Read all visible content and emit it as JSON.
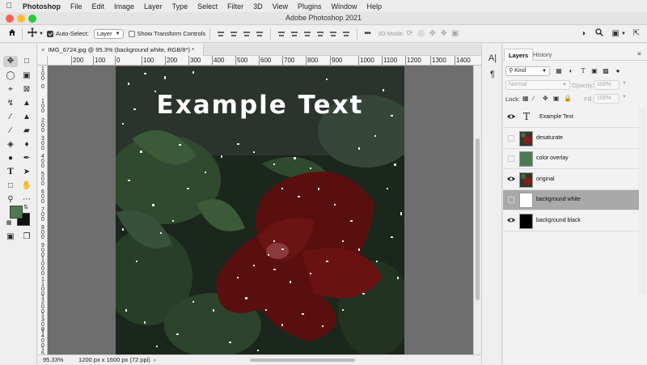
{
  "menubar": {
    "app": "Photoshop",
    "items": [
      "File",
      "Edit",
      "Image",
      "Layer",
      "Type",
      "Select",
      "Filter",
      "3D",
      "View",
      "Plugins",
      "Window",
      "Help"
    ]
  },
  "window": {
    "title": "Adobe Photoshop 2021"
  },
  "options_bar": {
    "auto_select_label": "Auto-Select:",
    "auto_select_value": "Layer",
    "show_transform_label": "Show Transform Controls",
    "mode_3d_label": "3D Mode:"
  },
  "document": {
    "tab_title": "IMG_6724.jpg @ 95.3% (background white, RGB/8*) *",
    "close_glyph": "×",
    "canvas_text": "Example Text"
  },
  "rulers": {
    "top": [
      "200",
      "100",
      "0",
      "100",
      "200",
      "300",
      "400",
      "500",
      "600",
      "700",
      "800",
      "900",
      "1000",
      "1100",
      "1200",
      "1300",
      "1400"
    ],
    "left": [
      "1\n0\n0",
      "0",
      "1\n0\n0",
      "2\n0\n0",
      "3\n0\n0",
      "4\n0\n0",
      "5\n0\n0",
      "6\n0\n0",
      "7\n0\n0",
      "8\n0\n0",
      "9\n0\n0",
      "1\n0\n0\n0",
      "1\n1\n0\n0",
      "1\n2\n0\n0",
      "1\n3\n0\n0",
      "1\n4\n0\n0",
      "1\n5\n0\n0"
    ]
  },
  "status": {
    "zoom": "95.33%",
    "dimensions": "1200 px x 1600 px (72 ppi)",
    "arrow": "›"
  },
  "colors": {
    "foreground": "#4d7a52",
    "background": "#111111",
    "selected_layer": "#a9a9a9"
  },
  "layers_panel": {
    "tabs": [
      "Layers",
      "History"
    ],
    "filter_label": "Kind",
    "blend_mode": "Normal",
    "opacity_label": "Opacity:",
    "opacity_value": "100%",
    "lock_label": "Lock:",
    "fill_label": "Fill:",
    "fill_value": "100%",
    "layers": [
      {
        "name": "Example Text",
        "visible": true,
        "kind": "text",
        "thumb_color": ""
      },
      {
        "name": "desaturate",
        "visible": false,
        "kind": "image",
        "thumb_color": "#2d3a2a"
      },
      {
        "name": "color overlay",
        "visible": false,
        "kind": "fill",
        "thumb_color": "#4d7a52"
      },
      {
        "name": "original",
        "visible": true,
        "kind": "image",
        "thumb_color": "#2b3b25"
      },
      {
        "name": "background white",
        "visible": false,
        "kind": "fill",
        "thumb_color": "#ffffff",
        "selected": true
      },
      {
        "name": "background black",
        "visible": true,
        "kind": "fill",
        "thumb_color": "#000000"
      }
    ]
  },
  "icons": {
    "apple": "apple-logo-icon",
    "home": "home-icon",
    "move": "move-tool-icon",
    "search": "search-icon",
    "eye": "eye-icon",
    "text_layer": "text-layer-icon"
  }
}
